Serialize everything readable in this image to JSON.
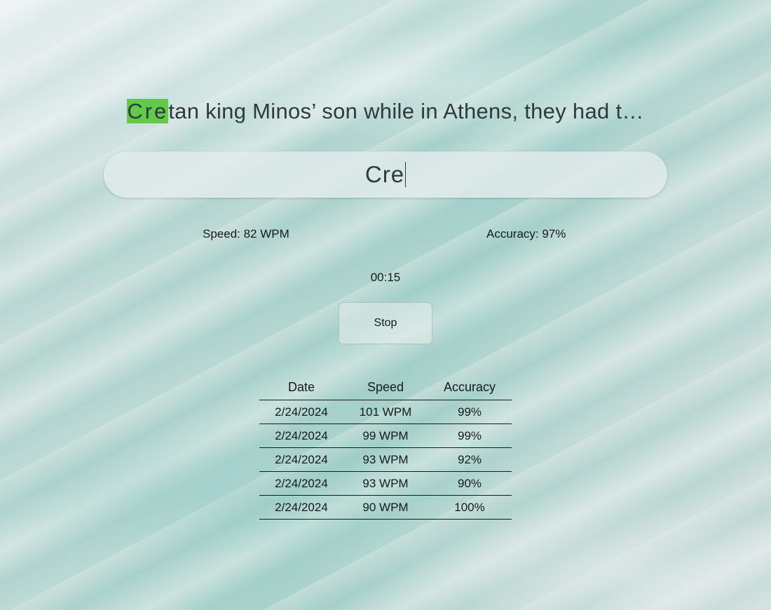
{
  "prompt": {
    "typed_part": "Cre",
    "remaining_part": "tan king Minos’ son while in Athens, they had t…"
  },
  "input": {
    "value": "Cre"
  },
  "stats": {
    "speed_label": "Speed: 82 WPM",
    "accuracy_label": "Accuracy: 97%"
  },
  "timer": "00:15",
  "controls": {
    "stop_label": "Stop"
  },
  "history": {
    "columns": [
      "Date",
      "Speed",
      "Accuracy"
    ],
    "rows": [
      [
        "2/24/2024",
        "101 WPM",
        "99%"
      ],
      [
        "2/24/2024",
        "99 WPM",
        "99%"
      ],
      [
        "2/24/2024",
        "93 WPM",
        "92%"
      ],
      [
        "2/24/2024",
        "93 WPM",
        "90%"
      ],
      [
        "2/24/2024",
        "90 WPM",
        "100%"
      ]
    ]
  },
  "colors": {
    "typed_highlight": "#62c94a",
    "text": "#2e3a3c",
    "background": "#bcd9d5"
  }
}
